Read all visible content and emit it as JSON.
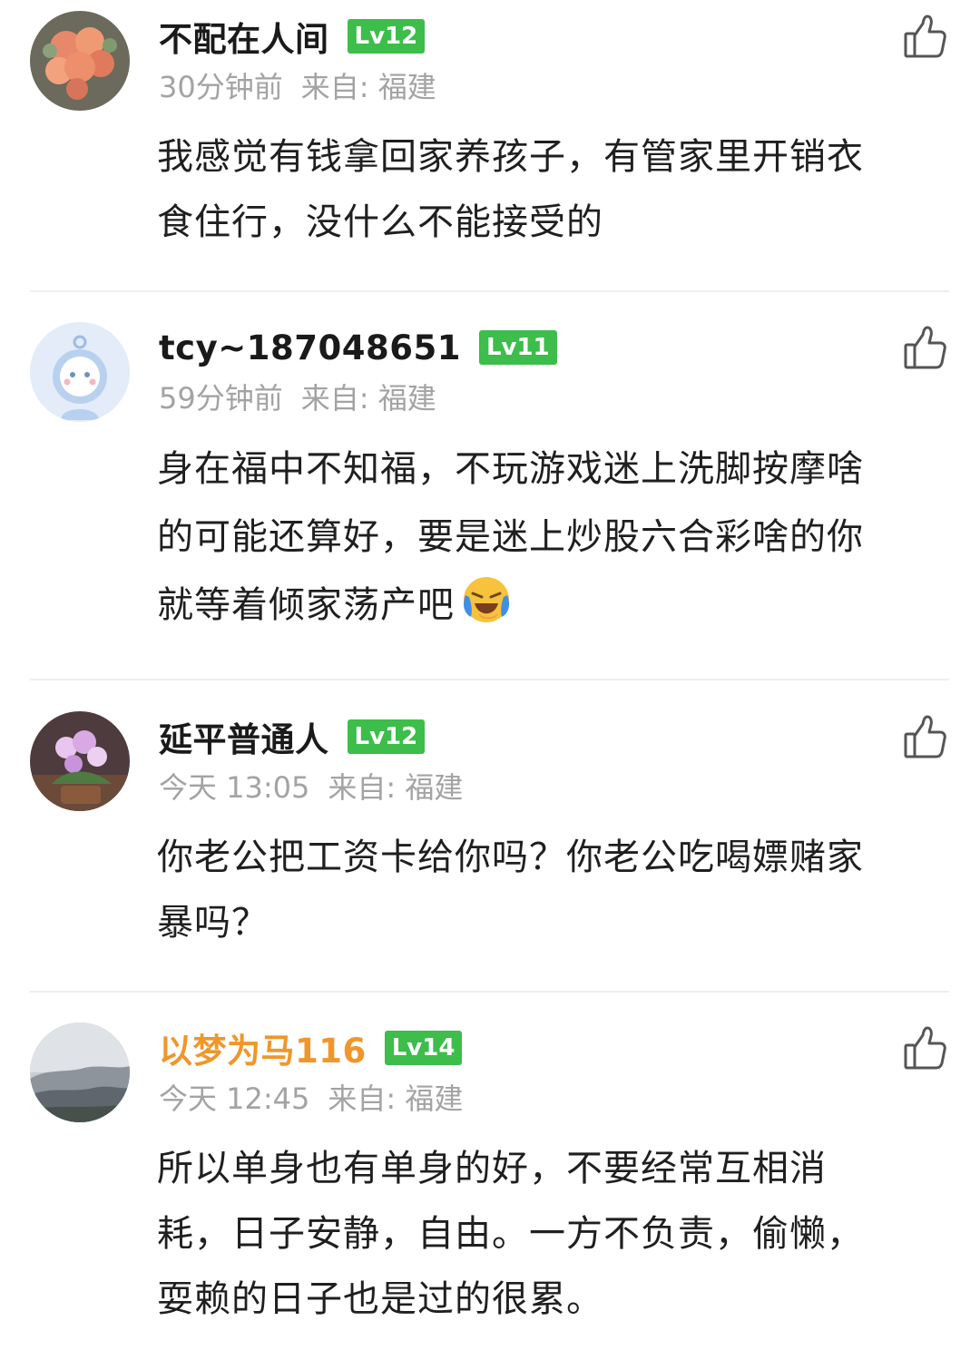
{
  "comments": [
    {
      "username": "不配在人间",
      "level": "Lv12",
      "time": "30分钟前",
      "source": "来自: 福建",
      "lines": [
        "我感觉有钱拿回家养孩子，有管家里开销衣",
        "食住行，没什么不能接受的"
      ]
    },
    {
      "username": "tcy~187048651",
      "level": "Lv11",
      "time": "59分钟前",
      "source": "来自: 福建",
      "lines": [
        "身在福中不知福，不玩游戏迷上洗脚按摩啥",
        "的可能还算好，要是迷上炒股六合彩啥的你",
        "就等着倾家荡产吧"
      ],
      "emoji": "laughing-crying-emoji"
    },
    {
      "username": "延平普通人",
      "level": "Lv12",
      "time": "今天 13:05",
      "source": "来自: 福建",
      "lines": [
        "你老公把工资卡给你吗？你老公吃喝嫖赌家",
        "暴吗？"
      ]
    },
    {
      "username": "以梦为马116",
      "level": "Lv14",
      "time": "今天 12:45",
      "source": "来自: 福建",
      "lines": [
        "所以单身也有单身的好，不要经常互相消",
        "耗，日子安静，自由。一方不负责，偷懒，",
        "耍赖的日子也是过的很累。"
      ]
    }
  ],
  "colors": {
    "level_badge": "#3dbd4a",
    "highlight_username": "#f0962a",
    "meta_text": "#a3a3a3",
    "divider": "#eeeeee"
  },
  "icons": {
    "like": "thumbs-up-icon"
  }
}
